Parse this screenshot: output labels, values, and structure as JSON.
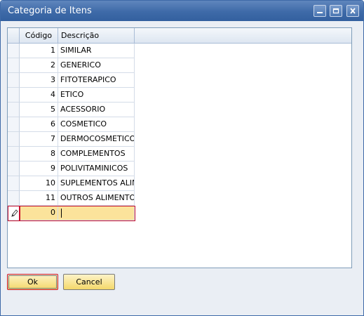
{
  "window": {
    "title": "Categoria de Itens",
    "controls": [
      "minimize-icon",
      "maximize-icon",
      "close-icon"
    ]
  },
  "grid": {
    "columns": [
      "Código",
      "Descrição"
    ],
    "rows": [
      {
        "code": "1",
        "desc": "SIMILAR"
      },
      {
        "code": "2",
        "desc": "GENERICO"
      },
      {
        "code": "3",
        "desc": "FITOTERAPICO"
      },
      {
        "code": "4",
        "desc": "ETICO"
      },
      {
        "code": "5",
        "desc": "ACESSORIO"
      },
      {
        "code": "6",
        "desc": "COSMETICO"
      },
      {
        "code": "7",
        "desc": "DERMOCOSMETICO"
      },
      {
        "code": "8",
        "desc": "COMPLEMENTOS"
      },
      {
        "code": "9",
        "desc": "POLIVITAMINICOS"
      },
      {
        "code": "10",
        "desc": "SUPLEMENTOS ALIM."
      },
      {
        "code": "11",
        "desc": "OUTROS ALIMENTOS"
      }
    ],
    "new_row": {
      "code": "0",
      "desc": "",
      "indicator_icon": "pencil-icon"
    }
  },
  "buttons": {
    "ok": "Ok",
    "cancel": "Cancel"
  },
  "colors": {
    "titlebar": "#3e6aa8",
    "edit_row": "#fbe39b",
    "focus_border": "#c8102e",
    "button_face": "#f4d86a"
  }
}
